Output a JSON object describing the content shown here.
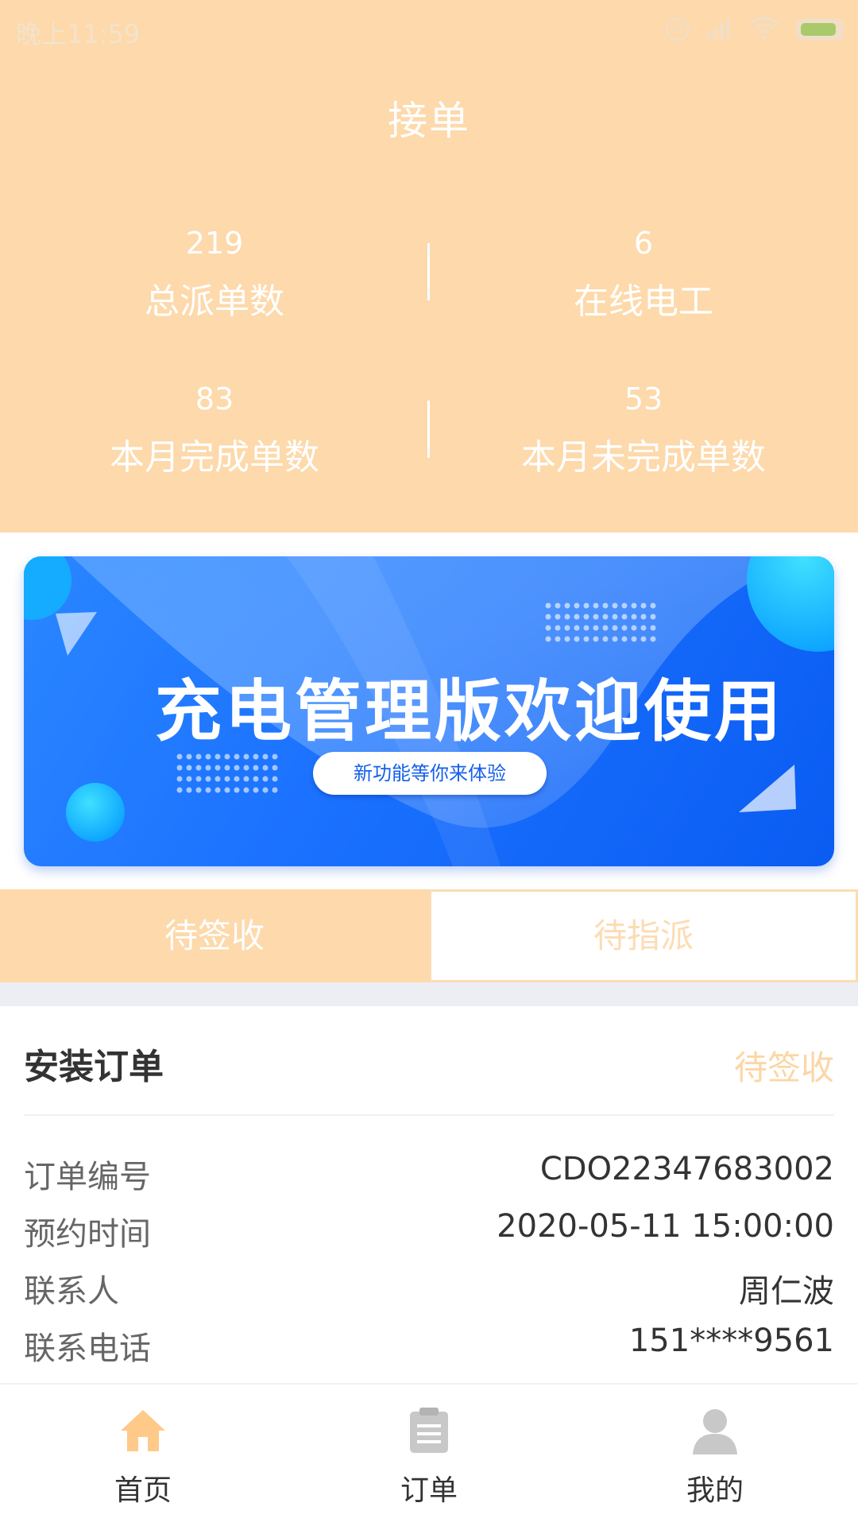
{
  "status_bar": {
    "time": "晚上11:59",
    "icons": [
      "registered-icon",
      "signal-icon",
      "wifi-icon",
      "battery-icon"
    ]
  },
  "header": {
    "title": "接单",
    "stats": [
      {
        "value": "219",
        "label": "总派单数"
      },
      {
        "value": "6",
        "label": "在线电工"
      },
      {
        "value": "83",
        "label": "本月完成单数"
      },
      {
        "value": "53",
        "label": "本月未完成单数"
      }
    ]
  },
  "banner": {
    "title": "充电管理版欢迎使用",
    "button_label": "新功能等你来体验"
  },
  "tabs": [
    {
      "label": "待签收",
      "active": true
    },
    {
      "label": "待指派",
      "active": false
    }
  ],
  "order_card": {
    "title": "安装订单",
    "status": "待签收",
    "rows": [
      {
        "key": "订单编号",
        "value": "CDO22347683002"
      },
      {
        "key": "预约时间",
        "value": "2020-05-11 15:00:00"
      },
      {
        "key": "联系人",
        "value": "周仁波"
      },
      {
        "key": "联系电话",
        "value": "151****9561"
      }
    ]
  },
  "bottom_nav": [
    {
      "label": "首页",
      "icon": "home-icon",
      "active": true
    },
    {
      "label": "订单",
      "icon": "clipboard-icon",
      "active": false
    },
    {
      "label": "我的",
      "icon": "user-icon",
      "active": false
    }
  ],
  "colors": {
    "header_bg": "#fdd9ab",
    "accent": "#fcd6a5",
    "banner_blue": "#1c73ff",
    "nav_active": "#ffc98a",
    "nav_idle": "#c8c8c8"
  }
}
